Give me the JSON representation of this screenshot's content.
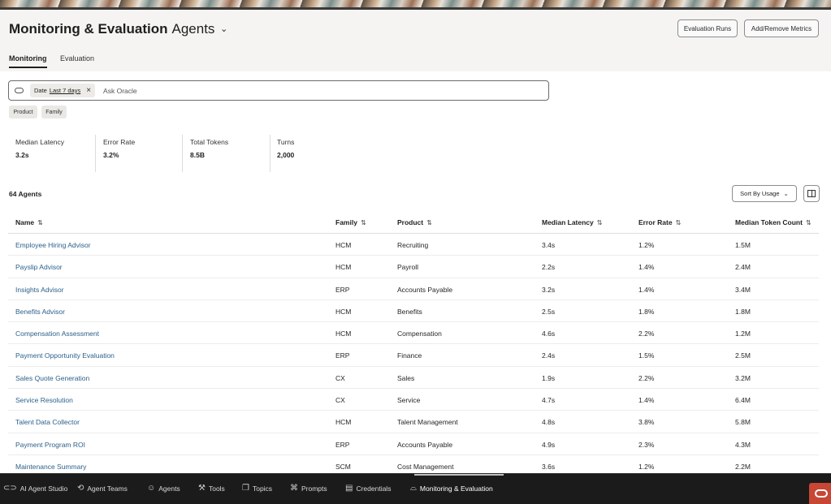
{
  "header": {
    "title": "Monitoring & Evaluation",
    "context": "Agents",
    "context_chevron": "⌄",
    "buttons": {
      "evaluation_runs": "Evaluation Runs",
      "add_remove_metrics": "Add/Remove Metrics"
    }
  },
  "tabs": [
    {
      "label": "Monitoring",
      "active": true
    },
    {
      "label": "Evaluation",
      "active": false
    }
  ],
  "search": {
    "chip_label": "Date",
    "chip_value": "Last 7 days",
    "placeholder": "Ask Oracle"
  },
  "filters": [
    "Product",
    "Family"
  ],
  "metrics": [
    {
      "label": "Median Latency",
      "value": "3.2s"
    },
    {
      "label": "Error Rate",
      "value": "3.2%"
    },
    {
      "label": "Total Tokens",
      "value": "8.5B"
    },
    {
      "label": "Turns",
      "value": "2,000"
    }
  ],
  "table": {
    "count_label": "64 Agents",
    "sort_label": "Sort By Usage",
    "columns": [
      "Name",
      "Family",
      "Product",
      "Median Latency",
      "Error Rate",
      "Median Token Count"
    ],
    "rows": [
      [
        "Employee Hiring Advisor",
        "HCM",
        "Recruiting",
        "3.4s",
        "1.2%",
        "1.5M"
      ],
      [
        "Payslip Advisor",
        "HCM",
        "Payroll",
        "2.2s",
        "1.4%",
        "2.4M"
      ],
      [
        "Insights Advisor",
        "ERP",
        "Accounts Payable",
        "3.2s",
        "1.4%",
        "3.4M"
      ],
      [
        "Benefits Advisor",
        "HCM",
        "Benefits",
        "2.5s",
        "1.8%",
        "1.8M"
      ],
      [
        "Compensation Assessment",
        "HCM",
        "Compensation",
        "4.6s",
        "2.2%",
        "1.2M"
      ],
      [
        "Payment Opportunity Evaluation",
        "ERP",
        "Finance",
        "2.4s",
        "1.5%",
        "2.5M"
      ],
      [
        "Sales Quote Generation",
        "CX",
        "Sales",
        "1.9s",
        "2.2%",
        "3.2M"
      ],
      [
        "Service Resolution",
        "CX",
        "Service",
        "4.7s",
        "1.4%",
        "6.4M"
      ],
      [
        "Talent Data Collector",
        "HCM",
        "Talent Management",
        "4.8s",
        "3.8%",
        "5.8M"
      ],
      [
        "Payment Program ROI",
        "ERP",
        "Accounts Payable",
        "4.9s",
        "2.3%",
        "4.3M"
      ],
      [
        "Maintenance Summary",
        "SCM",
        "Cost Management",
        "3.6s",
        "1.2%",
        "2.2M"
      ]
    ]
  },
  "taskbar": [
    {
      "label": "AI Agent Studio",
      "icon": "oracle-logo-icon"
    },
    {
      "label": "Agent Teams",
      "icon": "agent-teams-icon"
    },
    {
      "label": "Agents",
      "icon": "agents-icon"
    },
    {
      "label": "Tools",
      "icon": "tools-icon"
    },
    {
      "label": "Topics",
      "icon": "topics-icon"
    },
    {
      "label": "Prompts",
      "icon": "prompts-icon"
    },
    {
      "label": "Credentials",
      "icon": "credentials-icon"
    },
    {
      "label": "Monitoring & Evaluation",
      "icon": "monitoring-icon",
      "active": true
    }
  ],
  "colors": {
    "link": "#2b5f8a",
    "taskbar_bg": "#1b1b1b",
    "oracle_red": "#c74634"
  }
}
